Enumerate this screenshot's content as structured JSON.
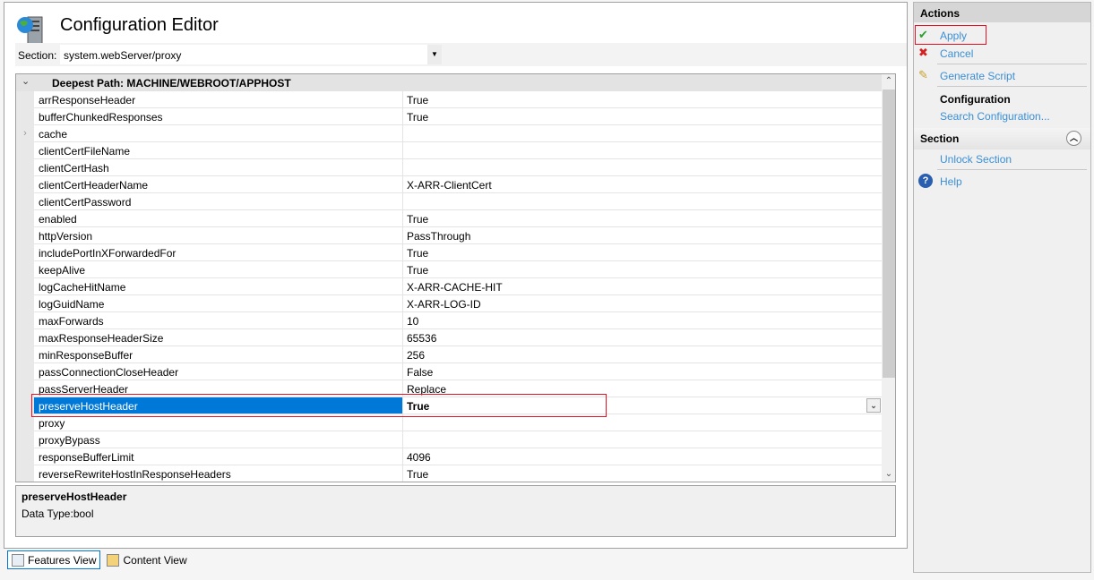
{
  "title": "Configuration Editor",
  "section": {
    "label": "Section:",
    "value": "system.webServer/proxy"
  },
  "grid": {
    "header": "Deepest Path: MACHINE/WEBROOT/APPHOST",
    "rows": [
      {
        "name": "arrResponseHeader",
        "value": "True"
      },
      {
        "name": "bufferChunkedResponses",
        "value": "True"
      },
      {
        "name": "cache",
        "value": "",
        "expandable": true
      },
      {
        "name": "clientCertFileName",
        "value": ""
      },
      {
        "name": "clientCertHash",
        "value": ""
      },
      {
        "name": "clientCertHeaderName",
        "value": "X-ARR-ClientCert"
      },
      {
        "name": "clientCertPassword",
        "value": ""
      },
      {
        "name": "enabled",
        "value": "True"
      },
      {
        "name": "httpVersion",
        "value": "PassThrough"
      },
      {
        "name": "includePortInXForwardedFor",
        "value": "True"
      },
      {
        "name": "keepAlive",
        "value": "True"
      },
      {
        "name": "logCacheHitName",
        "value": "X-ARR-CACHE-HIT"
      },
      {
        "name": "logGuidName",
        "value": "X-ARR-LOG-ID"
      },
      {
        "name": "maxForwards",
        "value": "10"
      },
      {
        "name": "maxResponseHeaderSize",
        "value": "65536"
      },
      {
        "name": "minResponseBuffer",
        "value": "256"
      },
      {
        "name": "passConnectionCloseHeader",
        "value": "False"
      },
      {
        "name": "passServerHeader",
        "value": "Replace"
      },
      {
        "name": "preserveHostHeader",
        "value": "True",
        "selected": true
      },
      {
        "name": "proxy",
        "value": ""
      },
      {
        "name": "proxyBypass",
        "value": ""
      },
      {
        "name": "responseBufferLimit",
        "value": "4096"
      },
      {
        "name": "reverseRewriteHostInResponseHeaders",
        "value": "True"
      }
    ]
  },
  "detail": {
    "name": "preserveHostHeader",
    "type": "Data Type:bool"
  },
  "tabs": [
    {
      "label": "Features View",
      "active": true
    },
    {
      "label": "Content View"
    }
  ],
  "actions": {
    "header": "Actions",
    "apply": "Apply",
    "cancel": "Cancel",
    "generate_script": "Generate Script",
    "configuration_group": "Configuration",
    "search_configuration": "Search Configuration...",
    "section_header": "Section",
    "unlock_section": "Unlock Section",
    "help": "Help"
  },
  "colors": {
    "selection": "#0078d7",
    "link": "#3a8fd6",
    "highlight_box": "#e81123"
  }
}
